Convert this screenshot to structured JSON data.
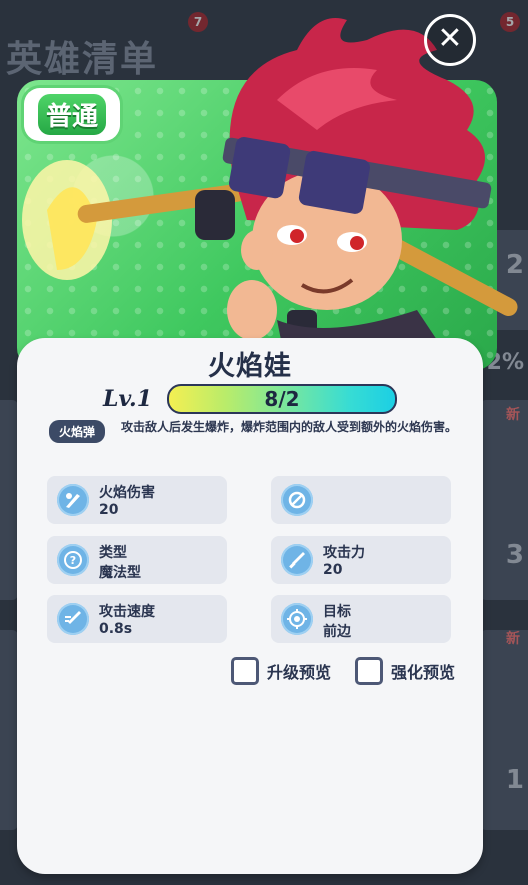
{
  "background": {
    "title": "英雄清单",
    "badges": [
      "7",
      "5"
    ],
    "side_percent": "2%",
    "side_numbers": [
      "2",
      "3",
      "1"
    ],
    "new_label": "新"
  },
  "hero": {
    "rarity": "普通",
    "name": "火焰娃",
    "level": "Lv.1",
    "progress_text": "8/2",
    "progress_fraction": 1.0
  },
  "skill": {
    "tag": "火焰弹",
    "description": "攻击敌人后发生爆炸，爆炸范围内的敌人受到额外的火焰伤害。"
  },
  "stats": [
    {
      "label": "火焰伤害",
      "value": "20",
      "icon": "fire-damage-icon"
    },
    {
      "label": "",
      "value": "",
      "icon": "disabled-icon"
    },
    {
      "label": "类型",
      "value": "魔法型",
      "icon": "question-icon"
    },
    {
      "label": "攻击力",
      "value": "20",
      "icon": "sword-icon"
    },
    {
      "label": "攻击速度",
      "value": "0.8s",
      "icon": "attack-speed-icon"
    },
    {
      "label": "目标",
      "value": "前边",
      "icon": "target-icon"
    }
  ],
  "checkboxes": {
    "upgrade_preview": "升级预览",
    "enhance_preview": "强化预览"
  },
  "colors": {
    "rarity_green": "#3fc85f",
    "panel_bg": "#f5f6f8",
    "stat_bg": "#e4e7ee",
    "icon_blue": "#6fb4e6",
    "text_dark": "#253049"
  }
}
